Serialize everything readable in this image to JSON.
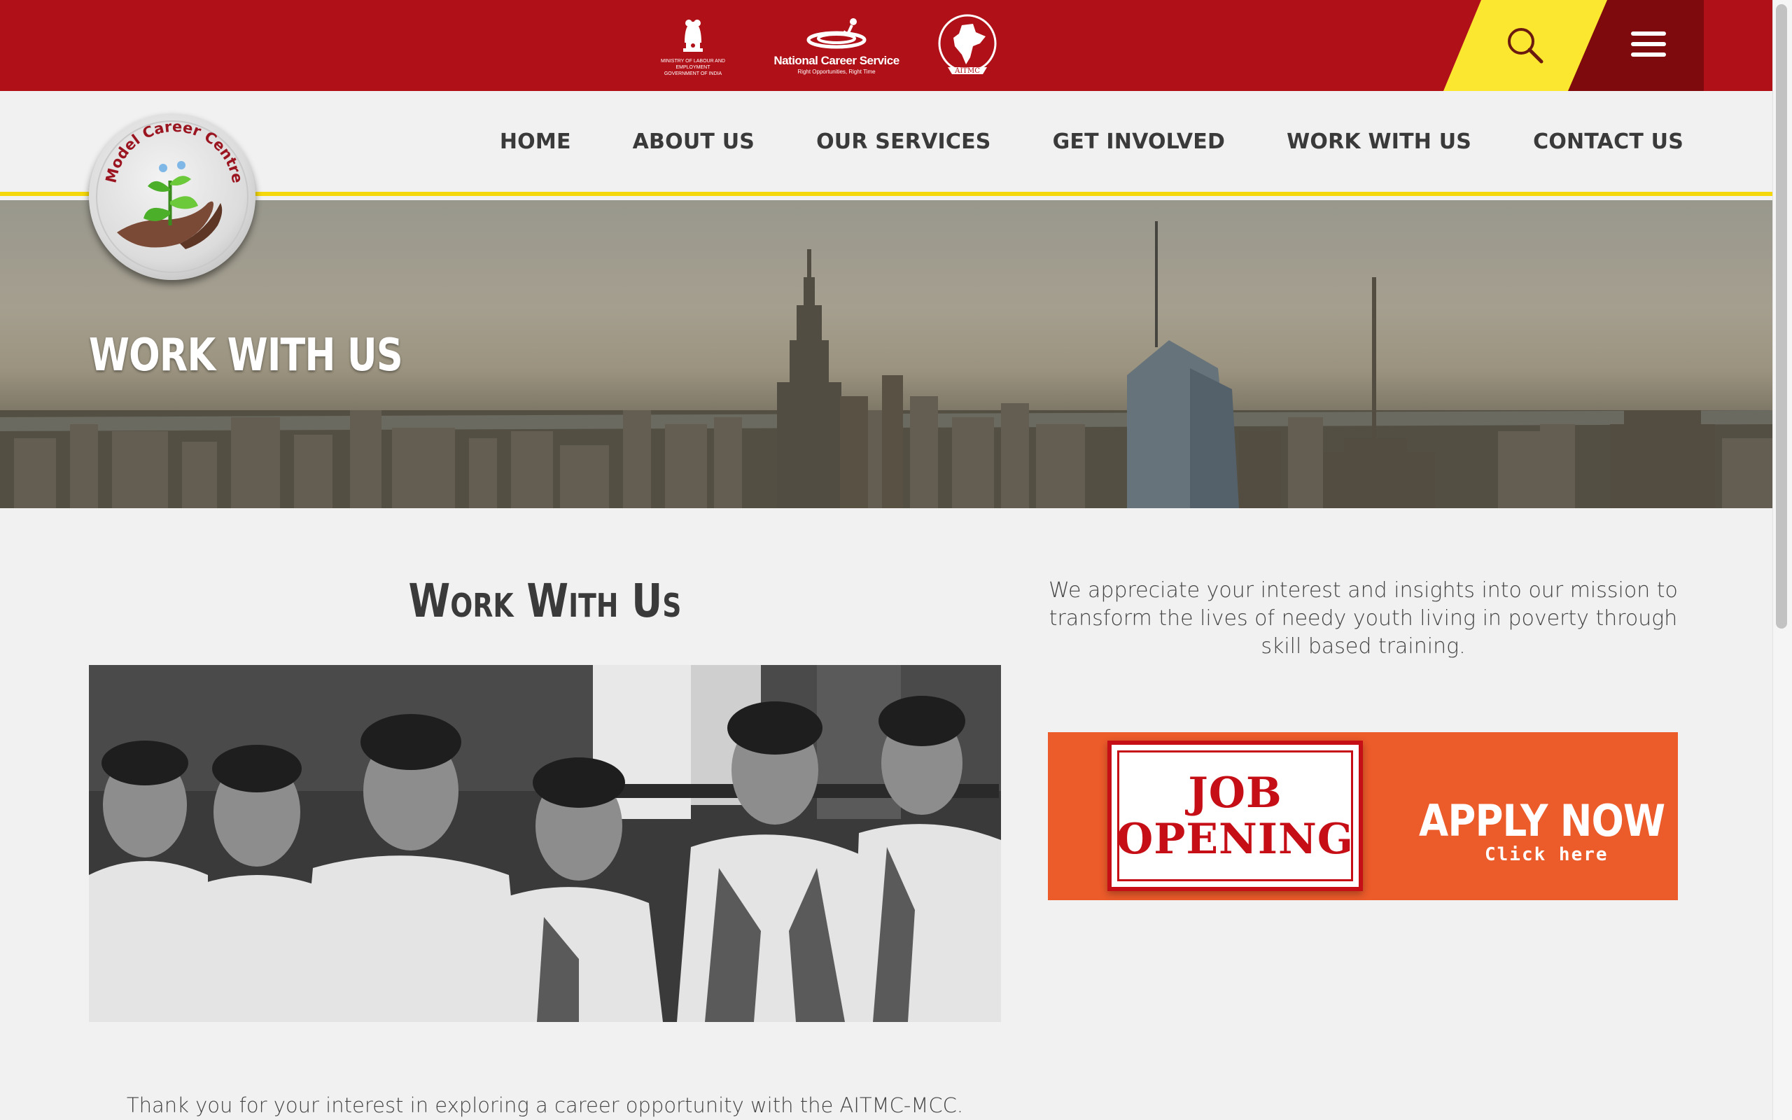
{
  "gov_logos": {
    "emblem_caption": "MINISTRY OF LABOUR AND EMPLOYMENT\nGOVERNMENT OF INDIA",
    "ncs_title": "National Career Service",
    "ncs_tagline": "Right Opportunities, Right Time",
    "aitmc_label": "AITMC"
  },
  "header": {
    "search_icon": "search-icon",
    "menu_icon": "hamburger-menu-icon",
    "colors": {
      "red": "#b01018",
      "yellow": "#fbe630",
      "dark_red": "#7f0a0e"
    }
  },
  "logo": {
    "ring_text": "Model Career Centre"
  },
  "nav": {
    "items": [
      {
        "label": "HOME"
      },
      {
        "label": "ABOUT US"
      },
      {
        "label": "OUR SERVICES"
      },
      {
        "label": "GET INVOLVED"
      },
      {
        "label": "WORK WITH US"
      },
      {
        "label": "CONTACT US"
      }
    ]
  },
  "hero": {
    "title": "WORK WITH US"
  },
  "content": {
    "section_title": "Work With Us",
    "intro": "We appreciate your interest and insights into our mission to transform the lives of needy youth living in poverty through skill based training.",
    "banner": {
      "line1": "JOB",
      "line2": "OPENING",
      "cta": "APPLY NOW",
      "sub": "Click here"
    },
    "thanks": "Thank you for your interest in exploring a career opportunity with the AITMC-MCC."
  }
}
